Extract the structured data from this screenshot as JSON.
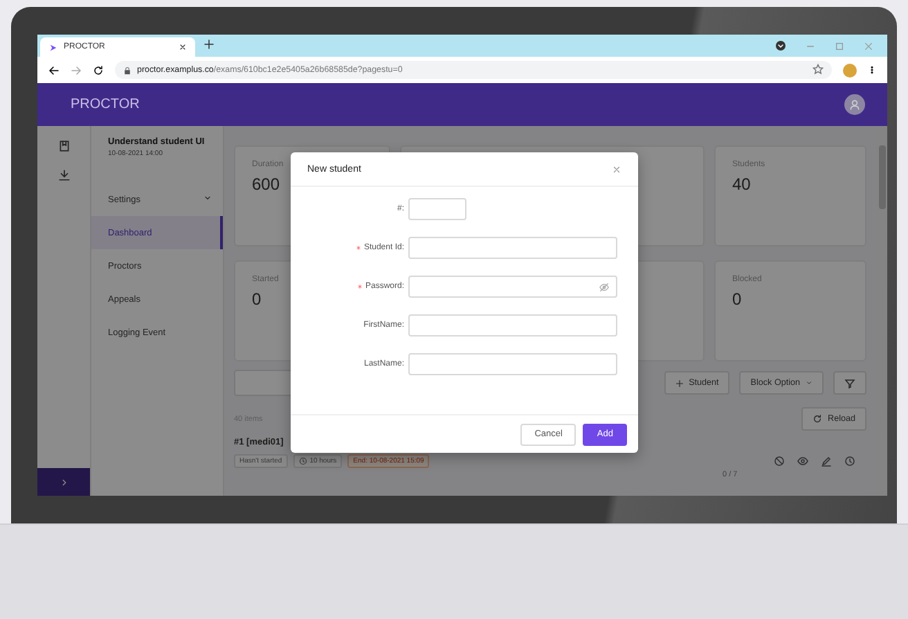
{
  "browser": {
    "tab_title": "PROCTOR",
    "url_host": "proctor.examplus.co",
    "url_path": "/exams/610bc1e2e5405a26b68585de?pagestu=0"
  },
  "app": {
    "brand": "PROCTOR"
  },
  "sidebar": {
    "exam_title": "Understand student UI",
    "exam_date": "10-08-2021 14:00",
    "items": [
      {
        "label": "Settings",
        "kind": "group",
        "selected": false
      },
      {
        "label": "Dashboard",
        "kind": "link",
        "selected": true
      },
      {
        "label": "Proctors",
        "kind": "link",
        "selected": false
      },
      {
        "label": "Appeals",
        "kind": "link",
        "selected": false
      },
      {
        "label": "Logging Event",
        "kind": "link",
        "selected": false
      }
    ]
  },
  "stats": [
    {
      "label": "Duration",
      "value": "600"
    },
    {
      "label": "Students",
      "value": "40"
    },
    {
      "label": "Started",
      "value": "0"
    },
    {
      "label": "Blocked",
      "value": "0"
    }
  ],
  "toolbar": {
    "add_student": "Student",
    "block_option": "Block Option"
  },
  "list": {
    "count": "40 items",
    "reload": "Reload",
    "items": [
      {
        "title": "#1 [medi01]",
        "status": "Hasn't started",
        "duration": "10 hours",
        "end": "End: 10-08-2021 15:09",
        "progress": "0 / 7"
      }
    ]
  },
  "modal": {
    "title": "New student",
    "fields": [
      {
        "label": "#:",
        "required": false,
        "kind": "short"
      },
      {
        "label": "Student Id:",
        "required": true,
        "kind": "text"
      },
      {
        "label": "Password:",
        "required": true,
        "kind": "password"
      },
      {
        "label": "FirstName:",
        "required": false,
        "kind": "text"
      },
      {
        "label": "LastName:",
        "required": false,
        "kind": "text"
      }
    ],
    "buttons": [
      {
        "label": "Cancel",
        "kind": "default"
      },
      {
        "label": "Add",
        "kind": "primary"
      }
    ]
  }
}
